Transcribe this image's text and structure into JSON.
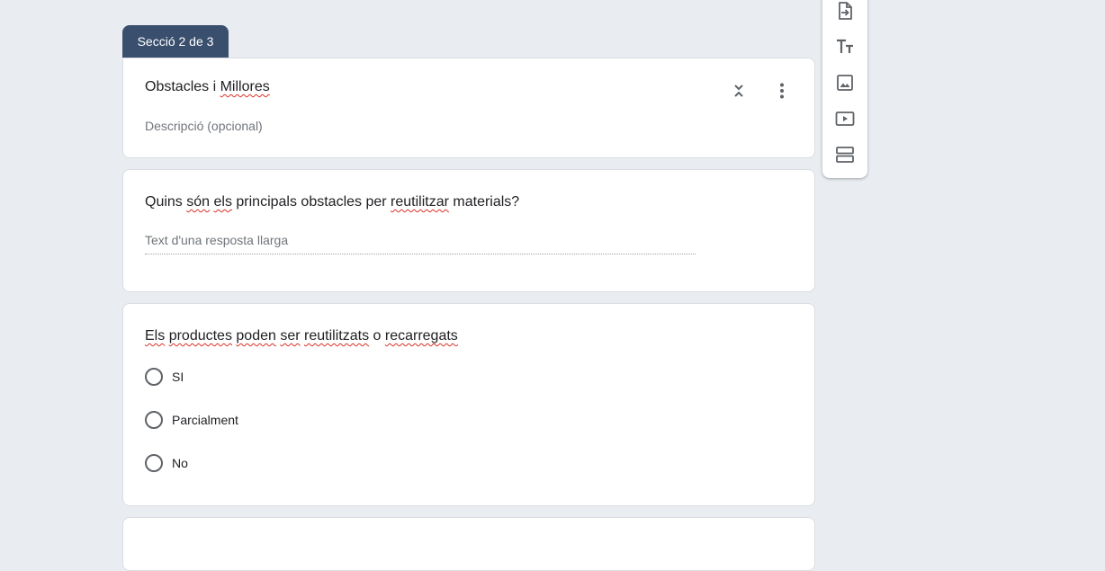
{
  "section": {
    "tab_label": "Secció 2 de 3",
    "title_parts": [
      "Obstacles i ",
      "Millores"
    ],
    "description_placeholder": "Descripció (opcional)"
  },
  "questions": [
    {
      "title_parts": [
        "Quins ",
        "són",
        " ",
        "els",
        " principals obstacles per ",
        "reutilitzar",
        " materials?"
      ],
      "type": "paragraph",
      "answer_placeholder": "Text d'una resposta llarga"
    },
    {
      "title_parts": [
        "Els",
        " ",
        "productes",
        " ",
        "poden",
        " ",
        "ser",
        " ",
        "reutilitzats",
        " o ",
        "recarregats"
      ],
      "type": "multiple_choice",
      "options": [
        "SI",
        "Parcialment",
        "No"
      ]
    }
  ],
  "toolbar": {
    "items": [
      "import-questions-icon",
      "add-title-icon",
      "add-image-icon",
      "add-video-icon",
      "add-section-icon"
    ]
  },
  "colors": {
    "background": "#e9edf1",
    "section_tab": "#3a4f6e",
    "icon": "#5f6368",
    "spellcheck": "#d93025"
  }
}
